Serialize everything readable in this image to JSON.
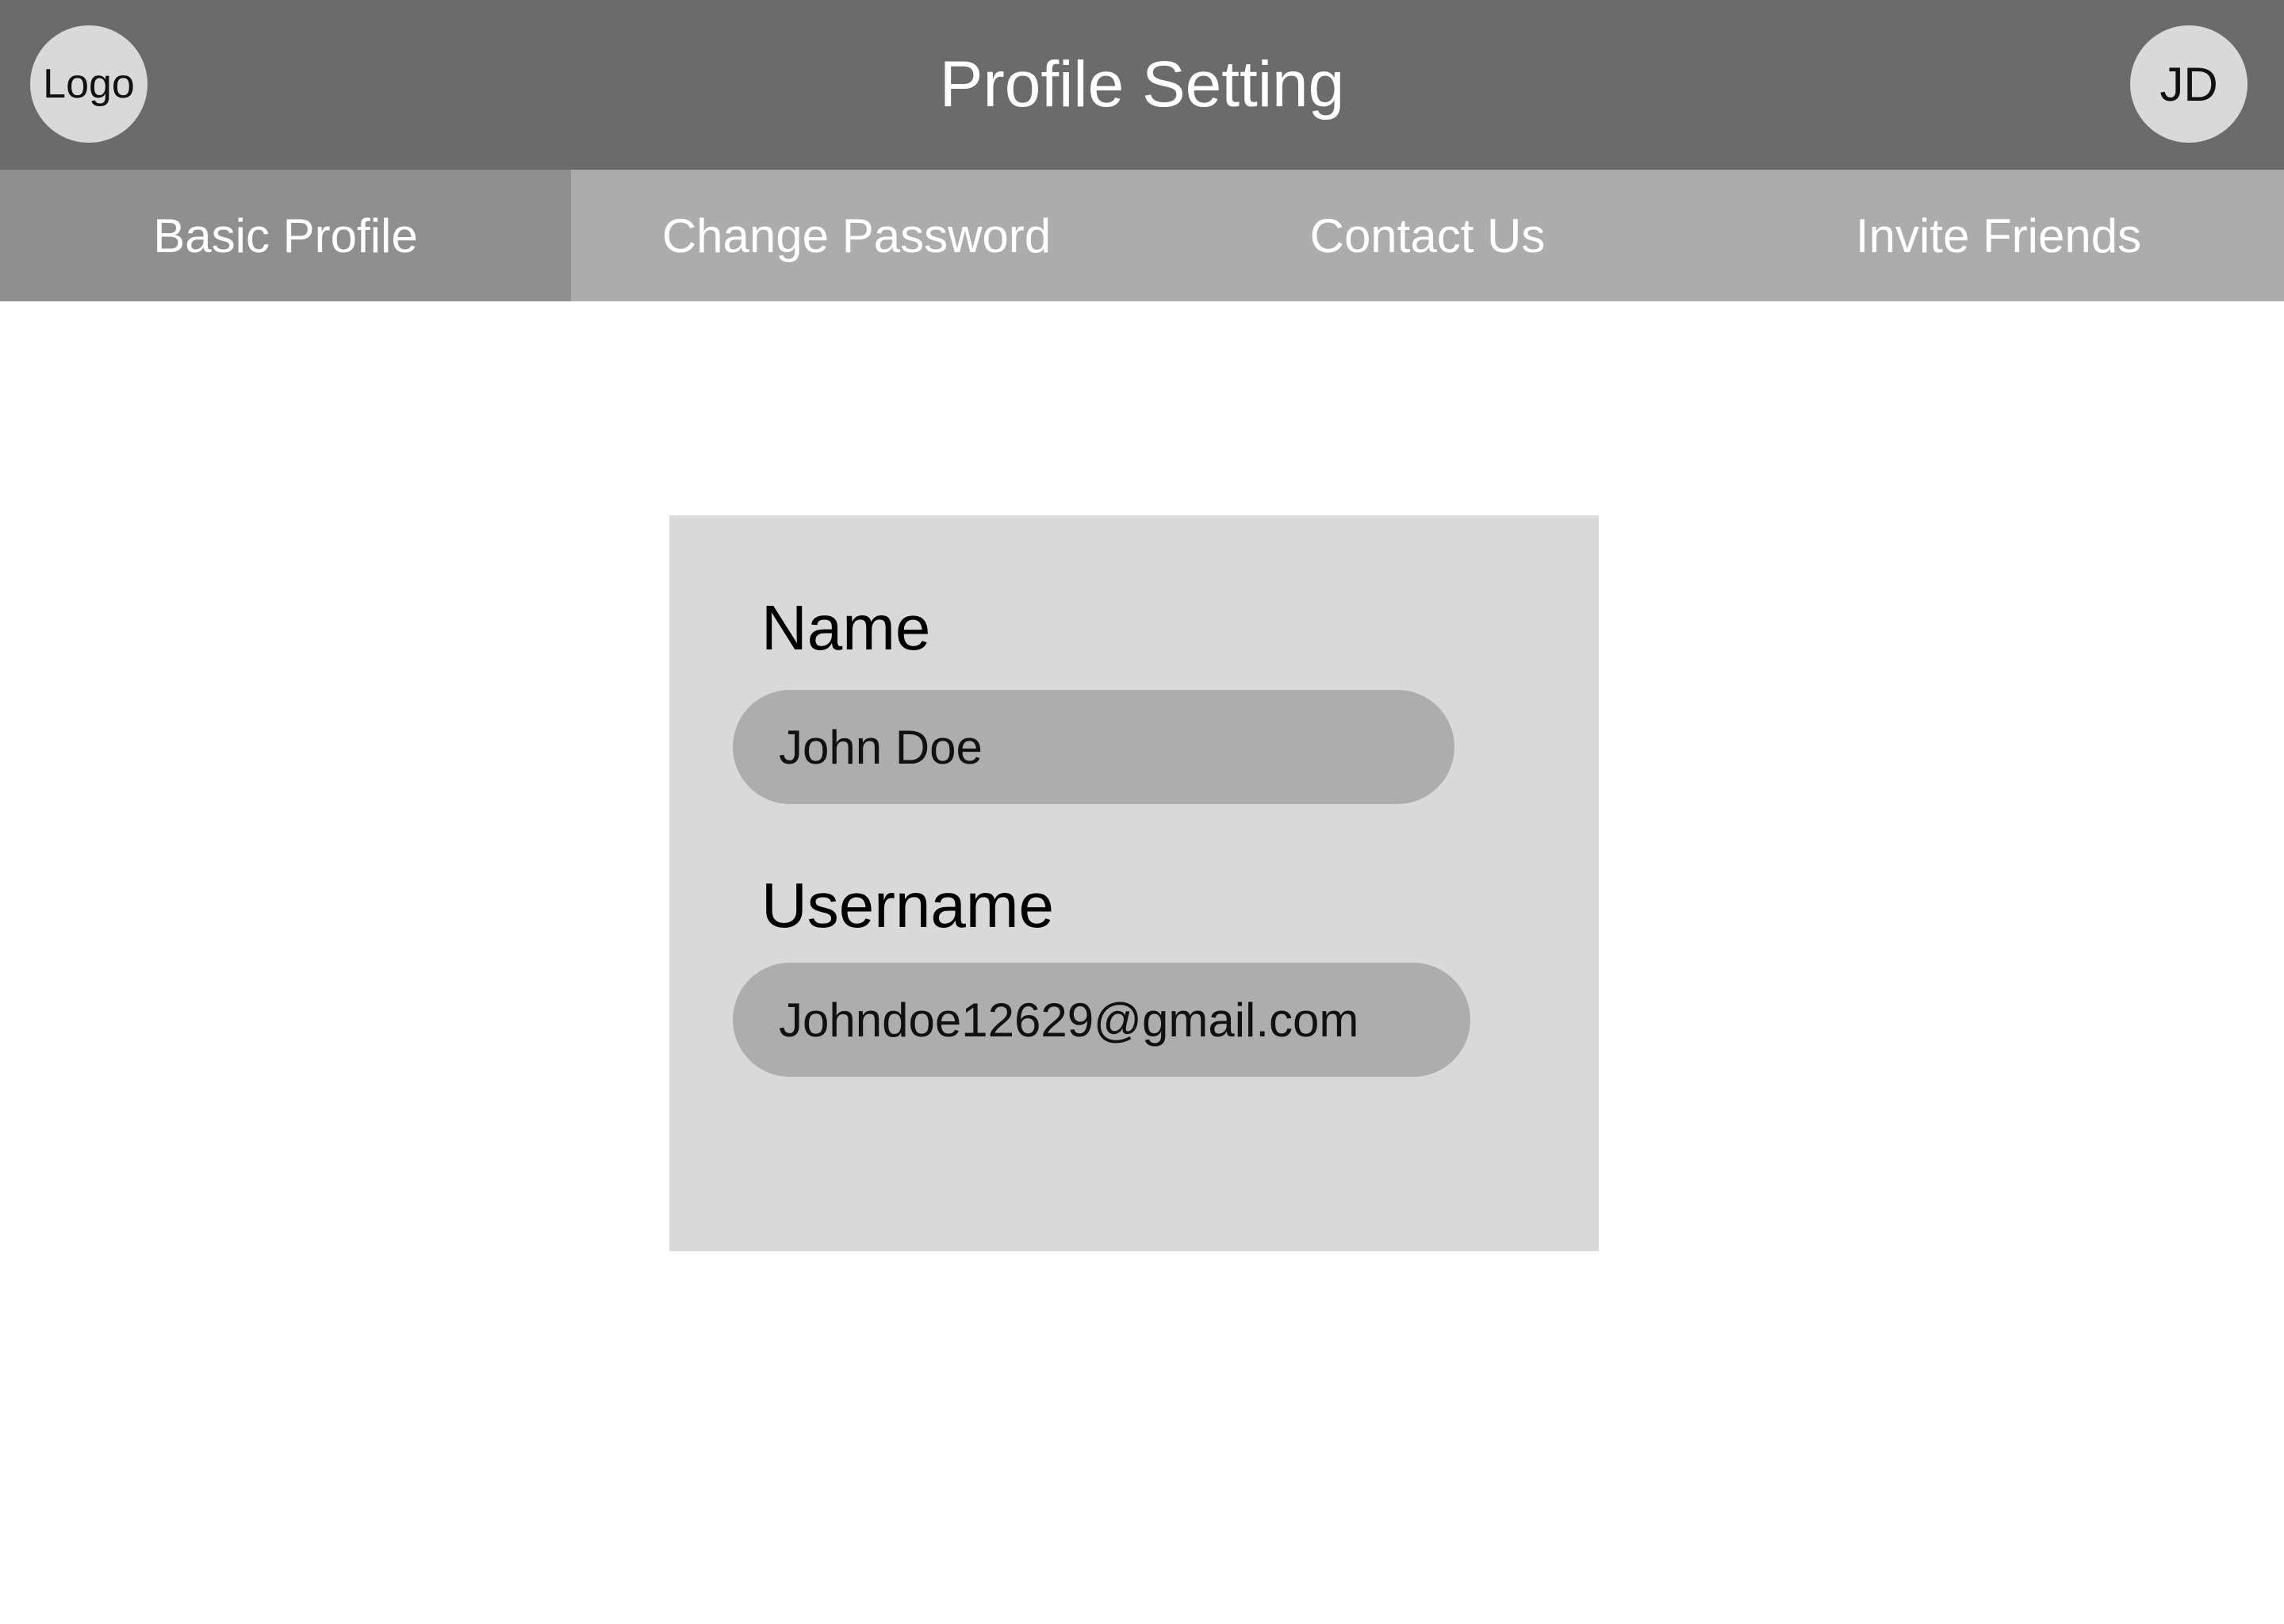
{
  "header": {
    "logo_label": "Logo",
    "title": "Profile Setting",
    "avatar_initials": "JD",
    "background_color": "#6b6b6b"
  },
  "tabs": [
    {
      "label": "Basic Profile",
      "active": true
    },
    {
      "label": "Change Password",
      "active": false
    },
    {
      "label": "Contact Us",
      "active": false
    },
    {
      "label": "Invite Friends",
      "active": false
    }
  ],
  "form": {
    "name": {
      "label": "Name",
      "value": "John Doe"
    },
    "username": {
      "label": "Username",
      "value": "Johndoe12629@gmail.com"
    }
  },
  "colors": {
    "tab_bar": "#acacac",
    "tab_active": "#8f8f8f",
    "card": "#d9d9d9",
    "input": "#adadad"
  }
}
